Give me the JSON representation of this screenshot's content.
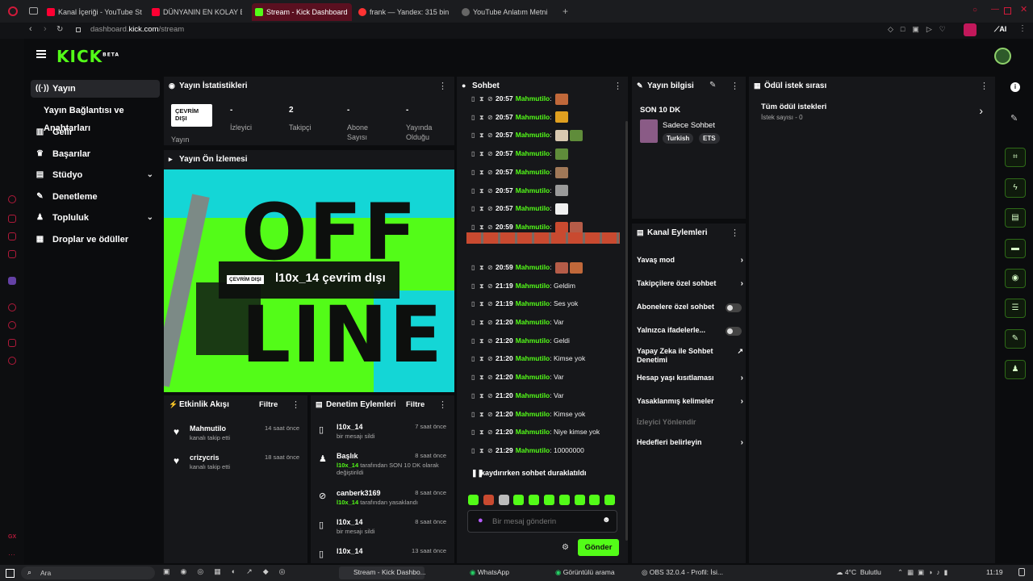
{
  "browser": {
    "tabs": [
      {
        "label": "Kanal İçeriği - YouTube St",
        "color": "#ff0033",
        "active": false
      },
      {
        "label": "DÜNYANIN EN KOLAY BA",
        "color": "#ff0033",
        "active": false
      },
      {
        "label": "Stream - Kick Dashboard",
        "color": "#53fc18",
        "active": true
      },
      {
        "label": "frank — Yandex: 315 bin s",
        "color": "#ff3333",
        "active": false
      },
      {
        "label": "YouTube Anlatım Metni",
        "color": "#888888",
        "active": false
      }
    ],
    "url": "dashboard.kick.com/stream",
    "url_host": "dashboard.",
    "url_bold": "kick.com",
    "url_path": "/stream",
    "ai_label": "AI"
  },
  "logo": {
    "text": "KICK",
    "beta": "BETA"
  },
  "sidenav": {
    "items": [
      {
        "label": "Yayın",
        "icon": "broadcast-icon"
      },
      {
        "label": "Yayın Bağlantısı ve Anahtarları",
        "icon": ""
      },
      {
        "label": "Gelir",
        "icon": "chart-icon"
      },
      {
        "label": "Başarılar",
        "icon": "trophy-icon"
      },
      {
        "label": "Stüdyo",
        "icon": "studio-icon"
      },
      {
        "label": "Denetleme",
        "icon": "wrench-icon"
      },
      {
        "label": "Topluluk",
        "icon": "people-icon"
      },
      {
        "label": "Droplar ve ödüller",
        "icon": "gift-icon"
      }
    ]
  },
  "stats": {
    "title": "Yayın İstatistikleri",
    "badge": "ÇEVRİM DIŞI",
    "items": [
      {
        "value": "",
        "label": "Yayın"
      },
      {
        "value": "-",
        "label": "İzleyici"
      },
      {
        "value": "2",
        "label": "Takipçi"
      },
      {
        "value": "-",
        "label": "Abone Sayısı"
      },
      {
        "value": "-",
        "label": "Yayında Olduğu"
      }
    ]
  },
  "preview": {
    "title": "Yayın Ön İzlemesi",
    "badge": "ÇEVRİM DIŞI",
    "offline_text": "l10x_14 çevrim dışı",
    "bg_text_top": "OFF",
    "bg_text_bottom": "LINE"
  },
  "activity": {
    "title": "Etkinlik Akışı",
    "filter": "Filtre",
    "events": [
      {
        "user": "Mahmutilo",
        "desc": "kanalı takip etti",
        "time": "14 saat önce"
      },
      {
        "user": "crizycris",
        "desc": "kanalı takip etti",
        "time": "18 saat önce"
      }
    ]
  },
  "modlog": {
    "title": "Denetim Eylemleri",
    "filter": "Filtre",
    "events": [
      {
        "icon": "trash-icon",
        "title": "l10x_14",
        "sub1": "",
        "sub2": "bir mesajı sildi",
        "time": "7 saat önce"
      },
      {
        "icon": "edit-user-icon",
        "title": "Başlık",
        "sub1": "l10x_14",
        "sub2": " tarafından SON 10 DK olarak değiştirildi",
        "time": "8 saat önce"
      },
      {
        "icon": "ban-icon",
        "title": "canberk3169",
        "sub1": "l10x_14",
        "sub2": " tarafından yasaklandı",
        "time": "8 saat önce"
      },
      {
        "icon": "trash-icon",
        "title": "l10x_14",
        "sub1": "",
        "sub2": "bir mesajı sildi",
        "time": "8 saat önce"
      },
      {
        "icon": "trash-icon",
        "title": "l10x_14",
        "sub1": "",
        "sub2": "",
        "time": "13 saat önce"
      }
    ]
  },
  "chat": {
    "title": "Sohbet",
    "messages": [
      {
        "time": "20:57",
        "user": "Mahmutilo",
        "text": "",
        "emotes": 1
      },
      {
        "time": "20:57",
        "user": "Mahmutilo",
        "text": "",
        "emotes": 1
      },
      {
        "time": "20:57",
        "user": "Mahmutilo",
        "text": "",
        "emotes": 2
      },
      {
        "time": "20:57",
        "user": "Mahmutilo",
        "text": "",
        "emotes": 1
      },
      {
        "time": "20:57",
        "user": "Mahmutilo",
        "text": "",
        "emotes": 1
      },
      {
        "time": "20:57",
        "user": "Mahmutilo",
        "text": "",
        "emotes": 1
      },
      {
        "time": "20:57",
        "user": "Mahmutilo",
        "text": "",
        "emotes": 1
      },
      {
        "time": "20:59",
        "user": "Mahmutilo",
        "text": "",
        "emotes": 3
      },
      {
        "time": "20:59",
        "user": "Mahmutilo",
        "text": "",
        "emotes": 2
      },
      {
        "time": "21:19",
        "user": "Mahmutilo",
        "text": "Geldim",
        "emotes": 0
      },
      {
        "time": "21:19",
        "user": "Mahmutilo",
        "text": "Ses yok",
        "emotes": 0
      },
      {
        "time": "21:20",
        "user": "Mahmutilo",
        "text": "Var",
        "emotes": 0
      },
      {
        "time": "21:20",
        "user": "Mahmutilo",
        "text": "Geldi",
        "emotes": 0
      },
      {
        "time": "21:20",
        "user": "Mahmutilo",
        "text": "Kimse yok",
        "emotes": 0
      },
      {
        "time": "21:20",
        "user": "Mahmutilo",
        "text": "Var",
        "emotes": 0
      },
      {
        "time": "21:20",
        "user": "Mahmutilo",
        "text": "Var",
        "emotes": 0
      },
      {
        "time": "21:20",
        "user": "Mahmutilo",
        "text": "Kimse yok",
        "emotes": 0
      },
      {
        "time": "21:20",
        "user": "Mahmutilo",
        "text": "Niye kimse yok",
        "emotes": 0
      },
      {
        "time": "21:29",
        "user": "Mahmutilo",
        "text": "10000000",
        "emotes": 0
      }
    ],
    "paused_notice": "kaydırırken sohbet duraklatıldı",
    "placeholder": "Bir mesaj gönderin",
    "send": "Gönder"
  },
  "streaminfo": {
    "title": "Yayın bilgisi",
    "stream_title": "SON 10 DK",
    "category": "Sadece Sohbet",
    "tags": [
      "Turkish",
      "ETS"
    ]
  },
  "channel_actions": {
    "title": "Kanal Eylemleri",
    "items": [
      {
        "label": "Yavaş mod",
        "kind": "arrow"
      },
      {
        "label": "Takipçilere özel sohbet",
        "kind": "arrow"
      },
      {
        "label": "Abonelere özel sohbet",
        "kind": "toggle"
      },
      {
        "label": "Yalnızca ifadelerle...",
        "kind": "toggle"
      },
      {
        "label": "Yapay Zeka ile Sohbet Denetimi",
        "kind": "external"
      },
      {
        "label": "Hesap yaşı kısıtlaması",
        "kind": "arrow"
      },
      {
        "label": "Yasaklanmış kelimeler",
        "kind": "arrow"
      },
      {
        "label": "İzleyici Yönlendir",
        "kind": "disabled"
      },
      {
        "label": "Hedefleri belirleyin",
        "kind": "arrow"
      }
    ]
  },
  "rewards": {
    "title": "Ödül istek sırası",
    "item_label": "Tüm ödül istekleri",
    "item_sub": "İstek sayısı - 0"
  },
  "taskbar": {
    "search": "Ara",
    "items": [
      "Stream - Kick Dashbo...",
      "WhatsApp",
      "Görüntülü arama",
      "OBS 32.0.4 - Profil: İsi..."
    ],
    "weather": "4°C",
    "weather_label": "Bulutlu",
    "clock": "11:19"
  },
  "colors": {
    "accent": "#53fc18",
    "offline_badge_bg": "#ffffff",
    "browser_accent": "#b11a3a"
  }
}
